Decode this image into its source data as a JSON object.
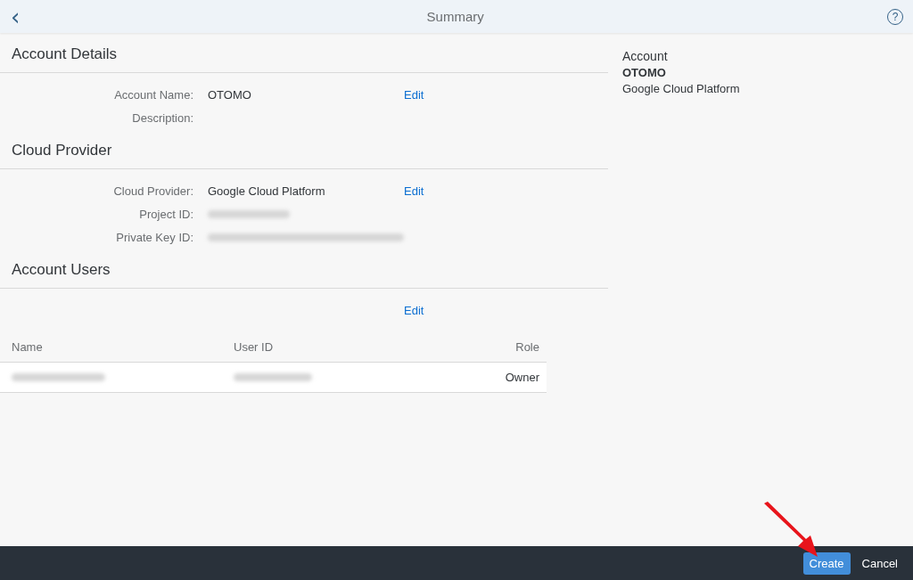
{
  "header": {
    "back": "‹",
    "title": "Summary",
    "help": "?"
  },
  "sections": [
    {
      "title": "Account Details",
      "rows": [
        {
          "label": "Account Name:",
          "value": "OTOMO",
          "edit": "Edit"
        },
        {
          "label": "Description:"
        }
      ]
    },
    {
      "title": "Cloud Provider",
      "rows": [
        {
          "label": "Cloud Provider:",
          "value": "Google Cloud Platform",
          "edit": "Edit"
        },
        {
          "label": "Project ID:",
          "redacted": true
        },
        {
          "label": "Private Key ID:",
          "redacted": true
        }
      ]
    },
    {
      "title": "Account Users",
      "rows": [
        {
          "edit": "Edit"
        }
      ],
      "table": {
        "columns": [
          "Name",
          "User ID",
          "Role"
        ],
        "rows": [
          [
            {
              "redacted": true
            },
            {
              "redacted": true
            },
            {
              "value": "Owner"
            }
          ]
        ]
      }
    }
  ],
  "side": {
    "heading": "Account",
    "name": "OTOMO",
    "provider": "Google Cloud Platform"
  },
  "footer": {
    "buttons": [
      {
        "label": "Create",
        "kind": "primary"
      },
      {
        "label": "Cancel",
        "kind": "plain"
      }
    ]
  }
}
